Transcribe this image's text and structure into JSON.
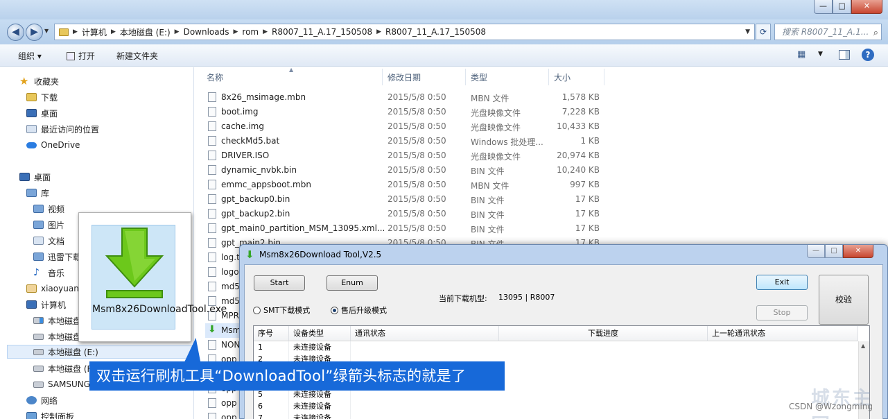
{
  "explorer": {
    "address": {
      "crumbs": [
        "计算机",
        "本地磁盘 (E:)",
        "Downloads",
        "rom",
        "R8007_11_A.17_150508",
        "R8007_11_A.17_150508"
      ],
      "search_placeholder": "搜索 R8007_11_A.1..."
    },
    "window_buttons": {
      "min": "—",
      "max": "□",
      "close": "✕"
    },
    "toolbar": {
      "organize": "组织 ▾",
      "open": "打开",
      "new_folder": "新建文件夹"
    },
    "nav": {
      "favorites": "收藏夹",
      "downloads": "下载",
      "desktop_fav": "桌面",
      "recent": "最近访问的位置",
      "onedrive": "OneDrive",
      "desktop": "桌面",
      "libraries": "库",
      "videos": "视频",
      "pictures": "图片",
      "documents": "文档",
      "xunlei": "迅雷下载",
      "music": "音乐",
      "user": "xiaoyuan",
      "computer": "计算机",
      "drive_c": "本地磁盘",
      "drive_d": "本地磁盘",
      "drive_e": "本地磁盘 (E:)",
      "drive_f": "本地磁盘 (F",
      "samsung": "SAMSUNG",
      "network": "网络",
      "control_panel": "控制面板"
    },
    "columns": {
      "name": "名称",
      "date": "修改日期",
      "type": "类型",
      "size": "大小"
    },
    "files": [
      {
        "name": "8x26_msimage.mbn",
        "date": "2015/5/8 0:50",
        "type": "MBN 文件",
        "size": "1,578 KB"
      },
      {
        "name": "boot.img",
        "date": "2015/5/8 0:50",
        "type": "光盘映像文件",
        "size": "7,228 KB"
      },
      {
        "name": "cache.img",
        "date": "2015/5/8 0:50",
        "type": "光盘映像文件",
        "size": "10,433 KB"
      },
      {
        "name": "checkMd5.bat",
        "date": "2015/5/8 0:50",
        "type": "Windows 批处理...",
        "size": "1 KB"
      },
      {
        "name": "DRIVER.ISO",
        "date": "2015/5/8 0:50",
        "type": "光盘映像文件",
        "size": "20,974 KB"
      },
      {
        "name": "dynamic_nvbk.bin",
        "date": "2015/5/8 0:50",
        "type": "BIN 文件",
        "size": "10,240 KB"
      },
      {
        "name": "emmc_appsboot.mbn",
        "date": "2015/5/8 0:50",
        "type": "MBN 文件",
        "size": "997 KB"
      },
      {
        "name": "gpt_backup0.bin",
        "date": "2015/5/8 0:50",
        "type": "BIN 文件",
        "size": "17 KB"
      },
      {
        "name": "gpt_backup2.bin",
        "date": "2015/5/8 0:50",
        "type": "BIN 文件",
        "size": "17 KB"
      },
      {
        "name": "gpt_main0_partition_MSM_13095.xml...",
        "date": "2015/5/8 0:50",
        "type": "BIN 文件",
        "size": "17 KB"
      },
      {
        "name": "gpt_main2.bin",
        "date": "2015/5/8 0:50",
        "type": "BIN 文件",
        "size": "17 KB"
      },
      {
        "name": "log.t",
        "date": "",
        "type": "",
        "size": ""
      },
      {
        "name": "logo",
        "date": "",
        "type": "",
        "size": ""
      },
      {
        "name": "md5",
        "date": "",
        "type": "",
        "size": ""
      },
      {
        "name": "md5",
        "date": "",
        "type": "",
        "size": ""
      },
      {
        "name": "MPR",
        "date": "",
        "type": "",
        "size": ""
      },
      {
        "name": "Msm",
        "date": "",
        "type": "",
        "size": ""
      },
      {
        "name": "NON",
        "date": "",
        "type": "",
        "size": ""
      },
      {
        "name": "opp",
        "date": "",
        "type": "",
        "size": ""
      },
      {
        "name": "opp",
        "date": "",
        "type": "",
        "size": ""
      },
      {
        "name": "opp",
        "date": "",
        "type": "",
        "size": ""
      },
      {
        "name": "opp",
        "date": "",
        "type": "",
        "size": ""
      },
      {
        "name": "opp",
        "date": "",
        "type": "",
        "size": ""
      },
      {
        "name": "opp",
        "date": "",
        "type": "",
        "size": ""
      }
    ]
  },
  "tool": {
    "title": "Msm8x26Download Tool,V2.5",
    "window_buttons": {
      "min": "—",
      "max": "□",
      "close": "✕"
    },
    "buttons": {
      "start": "Start",
      "enum": "Enum",
      "exit": "Exit",
      "stop": "Stop",
      "verify": "校验"
    },
    "current_model_label": "当前下载机型:",
    "current_model_value": "13095 | R8007",
    "mode_smt": "SMT下载模式",
    "mode_aftersale": "售后升级模式",
    "selected_mode": "售后升级模式",
    "table": {
      "headers": {
        "index": "序号",
        "device_type": "设备类型",
        "comm_status": "通讯状态",
        "progress": "下载进度",
        "last_status": "上一轮通讯状态"
      },
      "rows": [
        {
          "index": "1",
          "device_type": "未连接设备"
        },
        {
          "index": "2",
          "device_type": "未连接设备"
        },
        {
          "index": "3",
          "device_type": "未连接设备"
        },
        {
          "index": "4",
          "device_type": "未连接设备"
        },
        {
          "index": "5",
          "device_type": "未连接设备"
        },
        {
          "index": "6",
          "device_type": "未连接设备"
        },
        {
          "index": "7",
          "device_type": "未连接设备"
        }
      ]
    }
  },
  "overlay": {
    "exe_label": "Msm8x26DownloadTool.exe",
    "caption": "双击运行刷机工具“DownloadTool”绿箭头标志的就是了",
    "watermark_logo": "城东主网",
    "watermark_csdn": "CSDN @Wzongming"
  },
  "colors": {
    "caption_bg": "#1769d9",
    "exe_arrow": "#6cc81b",
    "tile_bg": "#cde6f7"
  }
}
